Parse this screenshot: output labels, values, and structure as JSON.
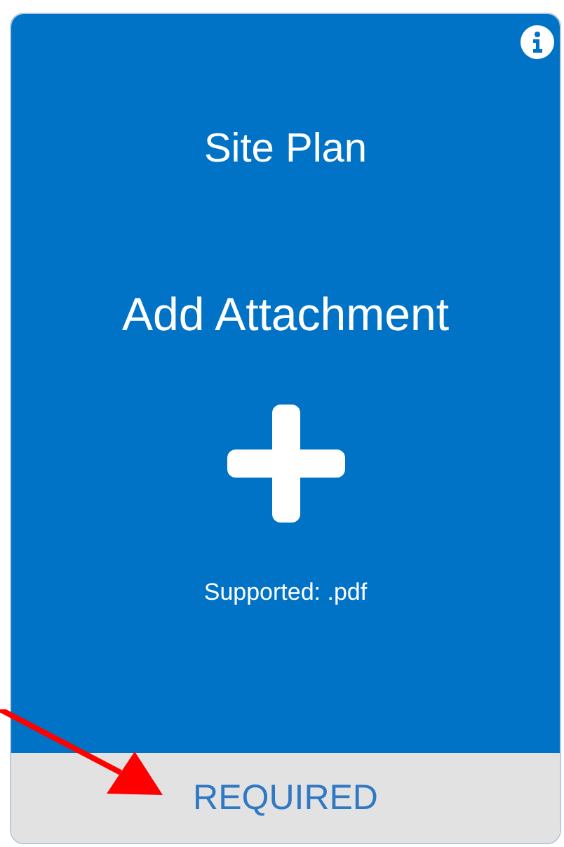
{
  "card": {
    "title": "Site Plan",
    "action": "Add Attachment",
    "supported": "Supported: .pdf",
    "footer": "REQUIRED",
    "required": true
  }
}
